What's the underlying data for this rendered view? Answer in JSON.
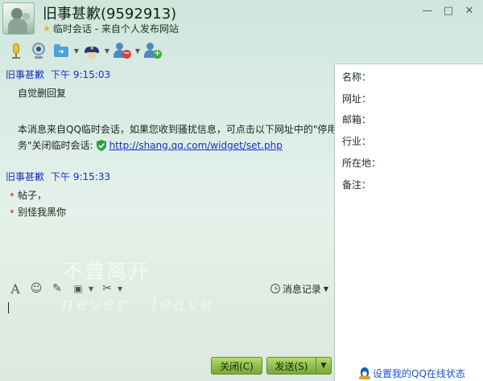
{
  "window": {
    "contact_name": "旧事甚歉(9592913)",
    "subtitle": "临时会话 - 来自个人发布网站",
    "controls": [
      "—",
      "□",
      "✕"
    ]
  },
  "messages": [
    {
      "sender": "旧事甚歉",
      "time": "下午 9:15:03",
      "lines": [
        "自觉删回复"
      ],
      "notice": "本消息来自QQ临时会话，如果您收到骚扰信息，可点击以下网址中的\"停用服",
      "notice2_prefix": "务\"关闭临时会话:",
      "link": "http://shang.qq.com/widget/set.php"
    },
    {
      "sender": "旧事甚歉",
      "time": "下午 9:15:33",
      "lines": [
        "帖子，",
        "别怪我黑你"
      ]
    }
  ],
  "watermark": {
    "line1": "不曾离开",
    "line2a": "never",
    "line2b": "leave"
  },
  "input_toolbar": {
    "history_label": "消息记录"
  },
  "buttons": {
    "close": "关闭(C)",
    "send": "发送(S)"
  },
  "info_panel": {
    "fields": [
      "名称：",
      "网址：",
      "邮箱：",
      "行业：",
      "所在地：",
      "备注："
    ],
    "set_status": "设置我的QQ在线状态"
  },
  "colors": {
    "accent_green": "#8fbd4a",
    "link_blue": "#1a2fc6",
    "background": "#d7eae3"
  }
}
